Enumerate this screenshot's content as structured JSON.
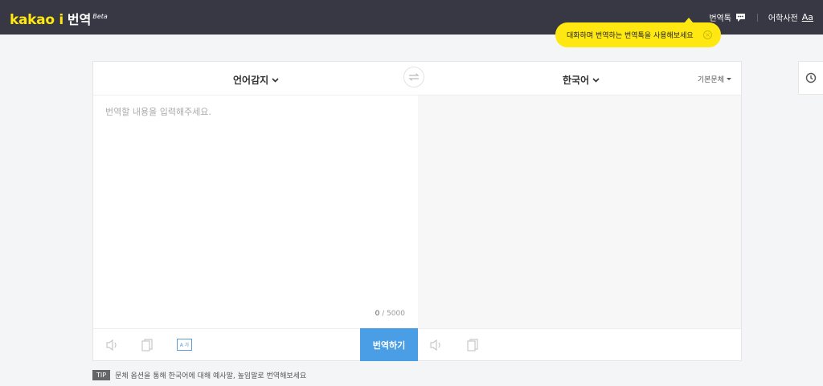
{
  "header": {
    "logo_kakao": "kakao i",
    "logo_service": "번역",
    "logo_beta": "Beta",
    "translate_talk": "번역톡",
    "dictionary": "어학사전",
    "dictionary_icon_text": "Aa",
    "icons": {
      "chat": "chat-bubble-icon"
    }
  },
  "tooltip": {
    "text": "대화하며 번역하는 번역톡을 사용해보세요",
    "close": "×"
  },
  "panel": {
    "source_lang": "언어감지",
    "target_lang": "한국어",
    "style": "기본문체",
    "placeholder": "번역할 내용을 입력해주세요.",
    "count_current": "0",
    "count_max": " / 5000",
    "translate_button": "번역하기",
    "pron_icon_text": "A 가"
  },
  "tip": {
    "badge": "TIP",
    "text": "문체 옵션을 통해 한국어에 대해 예사말, 높임말로 번역해보세요"
  },
  "colors": {
    "header_bg": "#373843",
    "brand_yellow": "#ffe812",
    "translate_button": "#4a9ee6"
  }
}
